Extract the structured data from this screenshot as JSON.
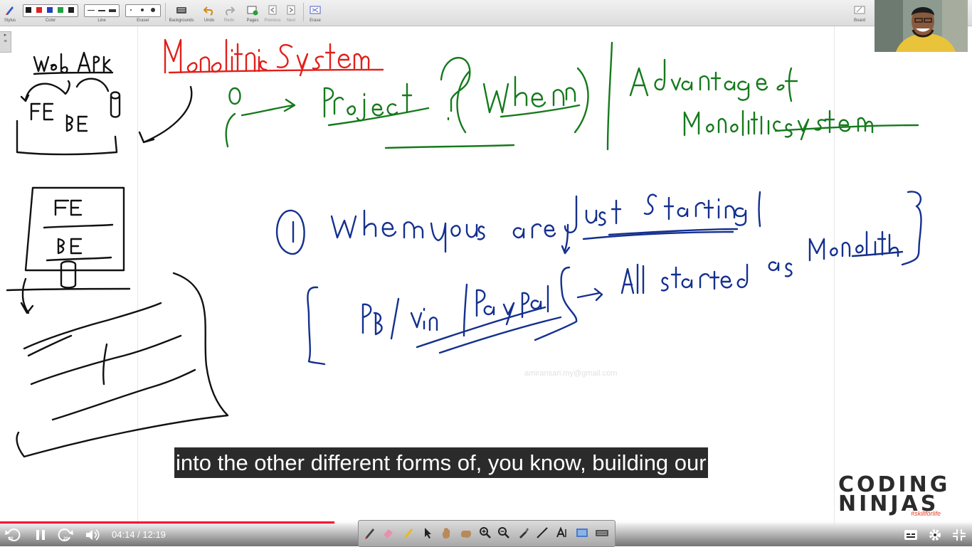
{
  "toolbar": {
    "groups": [
      {
        "label": "Stylus"
      },
      {
        "label": "Color"
      },
      {
        "label": "Line"
      },
      {
        "label": "Eraser"
      },
      {
        "label": "Backgrounds"
      },
      {
        "label": "Undo"
      },
      {
        "label": "Redo"
      },
      {
        "label": "Pages"
      },
      {
        "label": "Previous"
      },
      {
        "label": "Next"
      },
      {
        "label": "Erase"
      },
      {
        "label": "Board"
      }
    ],
    "colors": [
      "#1a1a1a",
      "#e02020",
      "#2040c0",
      "#20a040",
      "#202020"
    ]
  },
  "whiteboard": {
    "watermark": "amiransari.my@gmail.com",
    "ink_colors": {
      "black": "#111111",
      "red": "#e0201a",
      "green": "#157a1c",
      "blue": "#14308f"
    }
  },
  "caption": {
    "text": "into the other different forms of, you know, building our"
  },
  "logo": {
    "line1": "CODING",
    "line2": "NINJAS",
    "tagline": "#skillforlife"
  },
  "player": {
    "current_time": "04:14",
    "duration": "12:19",
    "time_display": "04:14 / 12:19",
    "progress": 0.344,
    "skip_back_seconds": "20",
    "skip_forward_seconds": "20"
  }
}
